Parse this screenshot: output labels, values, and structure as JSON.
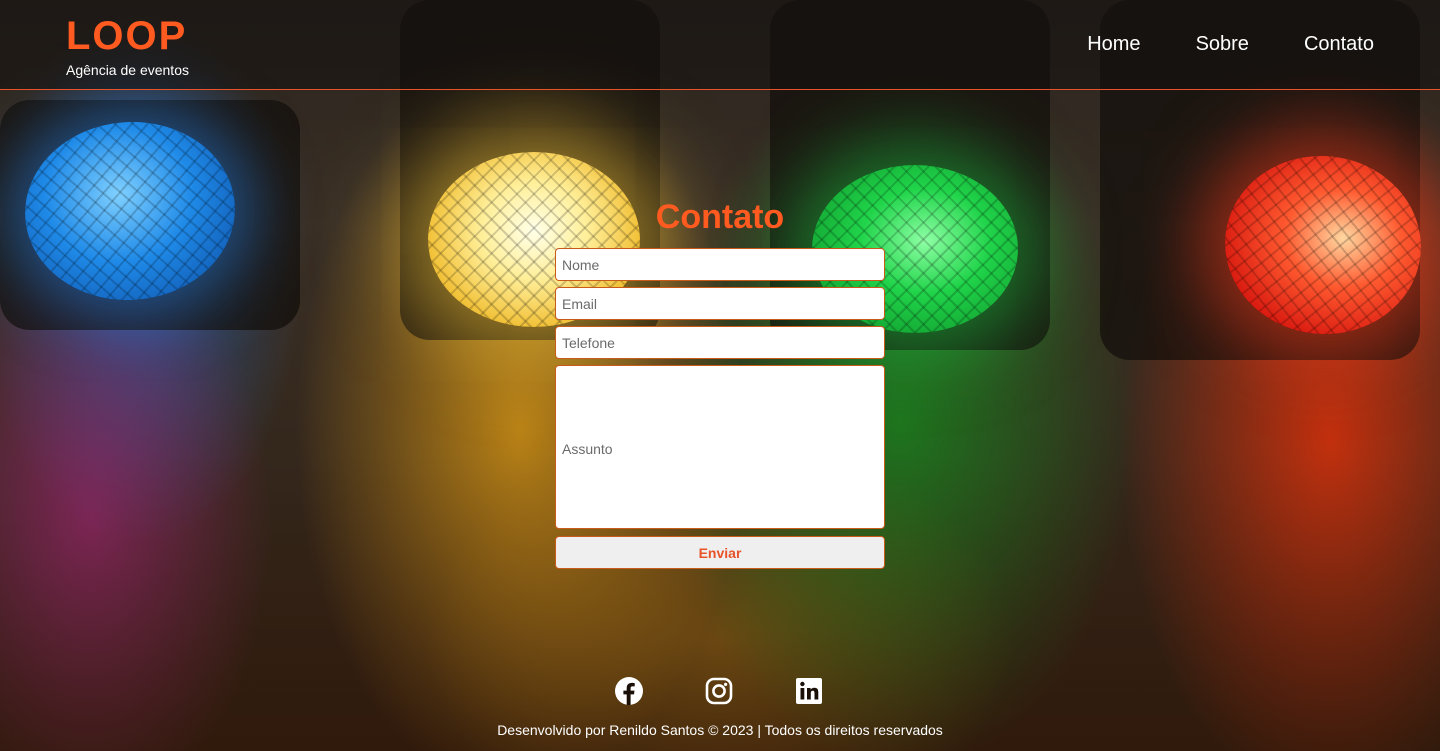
{
  "header": {
    "logo": "LOOP",
    "tagline": "Agência de eventos",
    "nav": [
      {
        "label": "Home"
      },
      {
        "label": "Sobre"
      },
      {
        "label": "Contato"
      }
    ]
  },
  "form": {
    "title": "Contato",
    "name_placeholder": "Nome",
    "email_placeholder": "Email",
    "phone_placeholder": "Telefone",
    "subject_placeholder": "Assunto",
    "submit_label": "Enviar"
  },
  "footer": {
    "social": [
      "facebook-icon",
      "instagram-icon",
      "linkedin-icon"
    ],
    "credits": "Desenvolvido por Renildo Santos © 2023 | Todos os direitos reservados"
  },
  "colors": {
    "accent": "#ff5a1f",
    "text_light": "#ffffff",
    "input_border": "#c85a1a"
  }
}
